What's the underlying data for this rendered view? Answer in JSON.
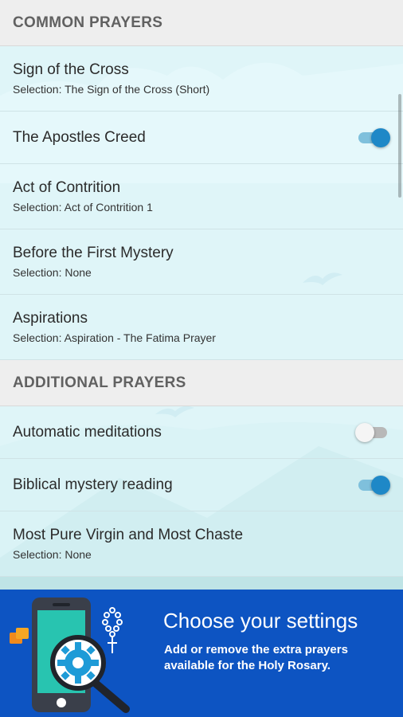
{
  "sections": {
    "common": {
      "header": "COMMON PRAYERS",
      "items": [
        {
          "title": "Sign of the Cross",
          "subtitle": "Selection: The Sign of the Cross (Short)"
        },
        {
          "title": "The Apostles Creed",
          "toggle": true
        },
        {
          "title": "Act of Contrition",
          "subtitle": "Selection: Act of Contrition 1"
        },
        {
          "title": "Before the First Mystery",
          "subtitle": "Selection: None"
        },
        {
          "title": "Aspirations",
          "subtitle": "Selection: Aspiration - The Fatima Prayer"
        }
      ]
    },
    "additional": {
      "header": "ADDITIONAL PRAYERS",
      "items": [
        {
          "title": "Automatic meditations",
          "toggle": false
        },
        {
          "title": "Biblical mystery reading",
          "toggle": true
        },
        {
          "title": "Most Pure Virgin and Most Chaste",
          "subtitle": "Selection: None"
        }
      ]
    }
  },
  "banner": {
    "title": "Choose your settings",
    "description": "Add or remove the extra prayers available for the Holy Rosary.",
    "illustration": "phone-gear-magnifier-rosary-icon"
  },
  "colors": {
    "accent": "#1e88c7",
    "banner": "#0d54c2",
    "header_bg": "#eeeeee",
    "background": "#dff4f7"
  }
}
